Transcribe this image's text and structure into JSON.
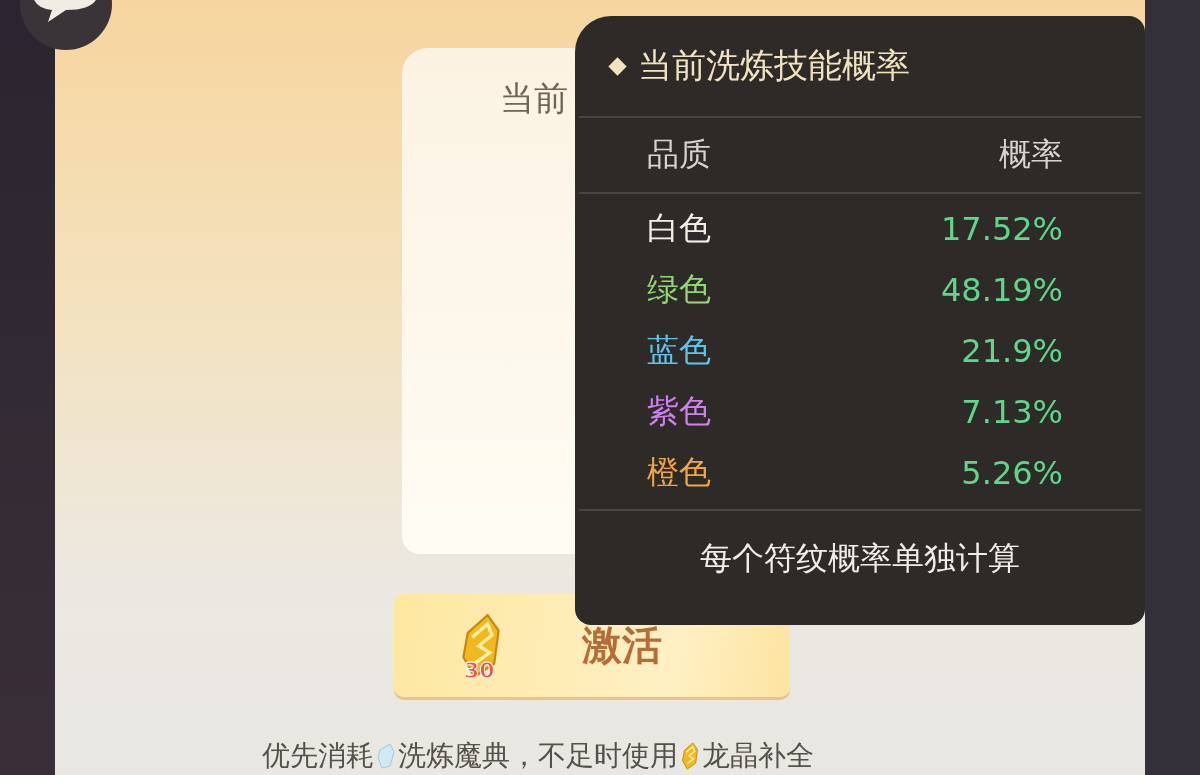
{
  "card": {
    "title": "当前"
  },
  "activate_button": {
    "label": "激活",
    "cost": "30"
  },
  "hint": [
    "优先消耗",
    "洗炼魔典，不足时使用",
    "龙晶补全"
  ],
  "popup": {
    "title": "当前洗炼技能概率",
    "columns": [
      "品质",
      "概率"
    ],
    "rows": [
      {
        "quality": "白色",
        "rate": "17.52%",
        "color": "#f2efe6"
      },
      {
        "quality": "绿色",
        "rate": "48.19%",
        "color": "#8fd872"
      },
      {
        "quality": "蓝色",
        "rate": "21.9%",
        "color": "#5fc4ec"
      },
      {
        "quality": "紫色",
        "rate": "7.13%",
        "color": "#d17ef0"
      },
      {
        "quality": "橙色",
        "rate": "5.26%",
        "color": "#f0a640"
      }
    ],
    "footer": "每个符纹概率单独计算"
  }
}
